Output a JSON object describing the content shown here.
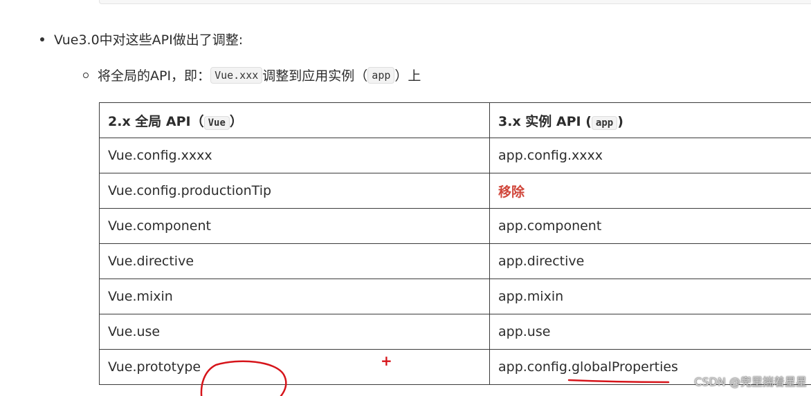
{
  "intro": {
    "bullet": "Vue3.0中对这些API做出了调整:",
    "sub_before": "将全局的API，即：",
    "sub_code": "Vue.xxx",
    "sub_middle": "调整到应用实例（",
    "sub_app_code": "app",
    "sub_after": "）上"
  },
  "table": {
    "header_left_text": "2.x 全局 API（",
    "header_left_code": "Vue",
    "header_left_close": "）",
    "header_right_text": "3.x 实例 API (",
    "header_right_code": "app",
    "header_right_close": ")",
    "rows": [
      {
        "left": "Vue.config.xxxx",
        "right": "app.config.xxxx"
      },
      {
        "left": "Vue.config.productionTip",
        "right": "移除"
      },
      {
        "left": "Vue.component",
        "right": "app.component"
      },
      {
        "left": "Vue.directive",
        "right": "app.directive"
      },
      {
        "left": "Vue.mixin",
        "right": "app.mixin"
      },
      {
        "left": "Vue.use",
        "right": "app.use"
      },
      {
        "left": "Vue.prototype",
        "right": "app.config.globalProperties"
      }
    ]
  },
  "annotations": {
    "plus": "+",
    "color": "#d6141a"
  },
  "watermark": "CSDN @兜里揣着星星",
  "colors": {
    "removed": "#d0463a",
    "border": "#3a3a3a"
  }
}
